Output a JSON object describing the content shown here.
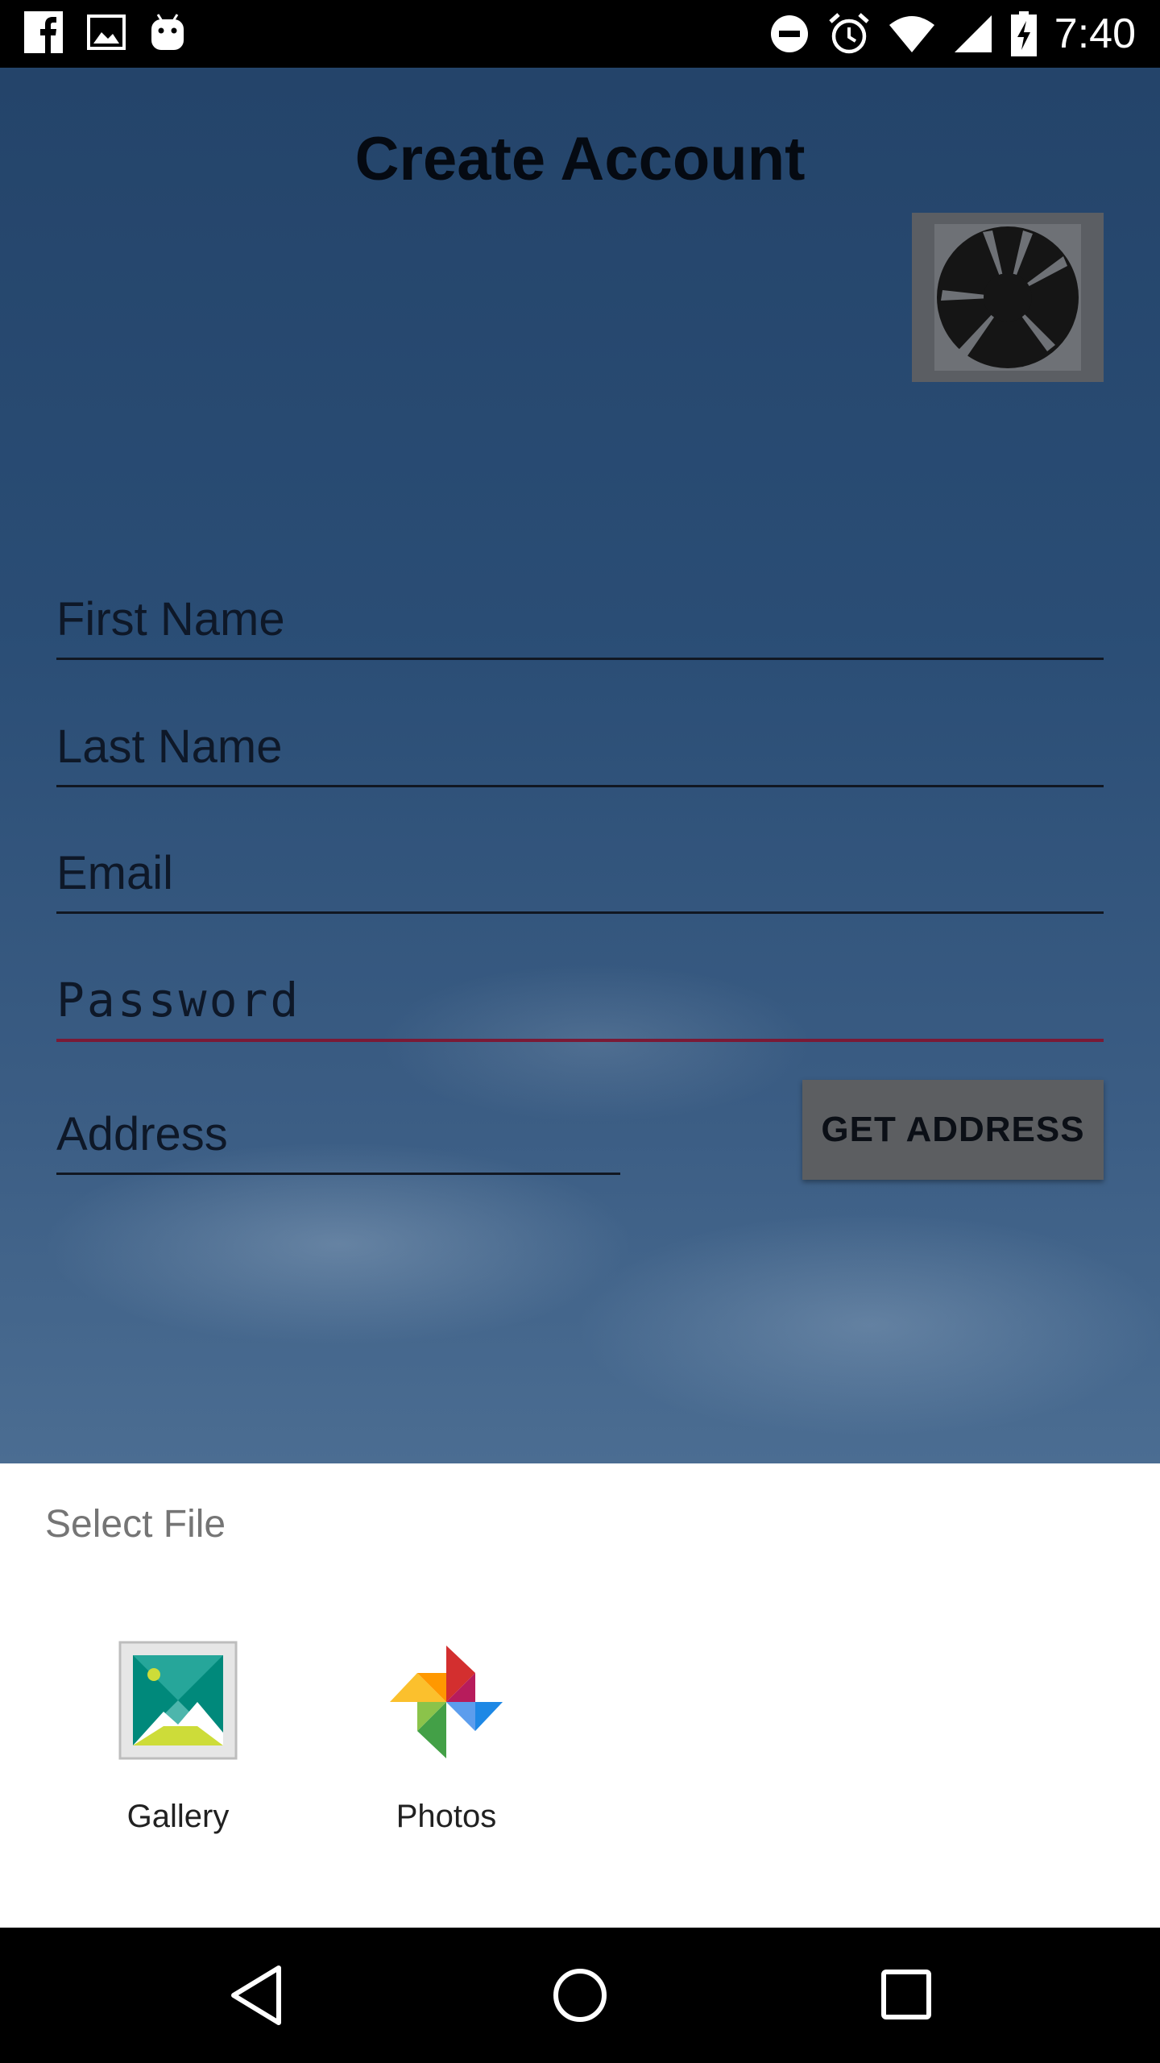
{
  "statusbar": {
    "time": "7:40",
    "left_icons": [
      "facebook-icon",
      "image-icon",
      "android-icon"
    ],
    "right_icons": [
      "do-not-disturb-icon",
      "alarm-icon",
      "wifi-icon",
      "signal-icon",
      "battery-charging-icon"
    ]
  },
  "app": {
    "title": "Create Account",
    "fields": {
      "first_name": "First Name",
      "last_name": "Last Name",
      "email": "Email",
      "password": "Password",
      "address": "Address"
    },
    "get_address_label": "GET ADDRESS"
  },
  "sheet": {
    "title": "Select File",
    "options": [
      {
        "label": "Gallery",
        "icon": "gallery-icon"
      },
      {
        "label": "Photos",
        "icon": "photos-icon"
      }
    ]
  },
  "navbar": {
    "buttons": [
      "back-icon",
      "home-icon",
      "recents-icon"
    ]
  }
}
